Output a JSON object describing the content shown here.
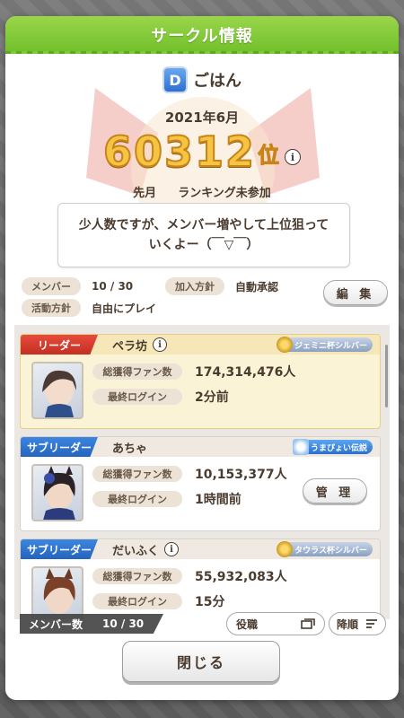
{
  "dialog": {
    "title": "サークル情報"
  },
  "circle": {
    "rank_badge": "D",
    "name": "ごはん",
    "month": "2021年6月",
    "rank": "60312",
    "rank_unit": "位",
    "last_month_label": "先月",
    "last_month_value": "ランキング未参加",
    "comment_line1": "少人数ですが、メンバー増やして上位狙って",
    "comment_line2": "いくよー（￣▽￣）"
  },
  "meta": {
    "members_label": "メンバー",
    "members_value": "10 / 30",
    "join_policy_label": "加入方針",
    "join_policy_value": "自動承認",
    "activity_label": "活動方針",
    "activity_value": "自由にプレイ"
  },
  "edit_button": "編 集",
  "members": [
    {
      "role": "リーダー",
      "name": "ペラ坊",
      "title": "ジェミニ杯シルバー",
      "fans_label": "総獲得ファン数",
      "fans_value": "174,314,476人",
      "login_label": "最終ログイン",
      "login_value": "2分前"
    },
    {
      "role": "サブリーダー",
      "name": "あちゃ",
      "title": "うまぴょい伝説",
      "fans_label": "総獲得ファン数",
      "fans_value": "10,153,377人",
      "login_label": "最終ログイン",
      "login_value": "1時間前",
      "manage": "管 理"
    },
    {
      "role": "サブリーダー",
      "name": "だいふく",
      "title": "タウラス杯シルバー",
      "fans_label": "総獲得ファン数",
      "fans_value": "55,932,083人",
      "login_label": "最終ログイン",
      "login_value": "15分"
    }
  ],
  "bottom": {
    "count_label": "メンバー数",
    "count_value": "10 / 30",
    "sort_role": "役職",
    "sort_order": "降順"
  },
  "close_button": "閉じる",
  "colors": {
    "header_green": "#6fbf2a",
    "leader_red": "#c32f22",
    "sub_blue": "#2464bd",
    "rank_gold": "#f5c443"
  }
}
